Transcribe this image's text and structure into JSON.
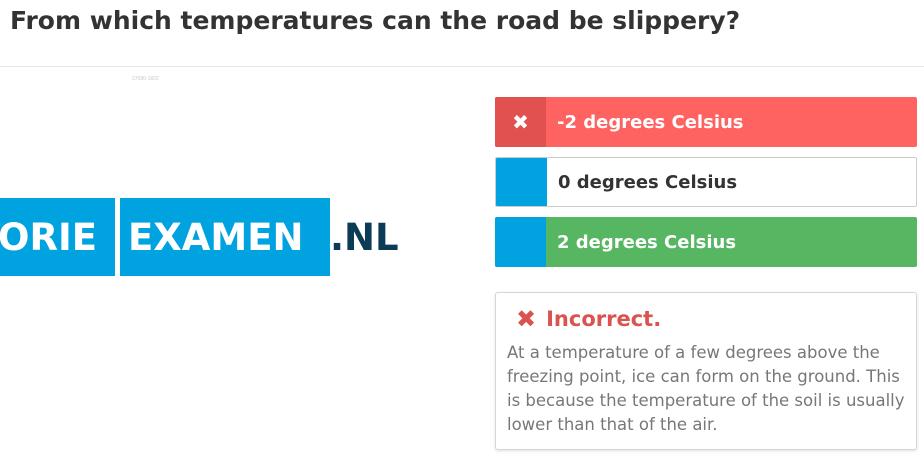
{
  "question": {
    "title": "From which temperatures can the road be slippery?"
  },
  "image": {
    "tiny_text": "27090-1822"
  },
  "logo": {
    "left": "ORIE",
    "right": "EXAMEN",
    "tld": ".NL"
  },
  "answers": [
    {
      "label": "-2 degrees Celsius",
      "state": "wrong",
      "marker_icon": "x-icon"
    },
    {
      "label": "0 degrees Celsius",
      "state": "neutral"
    },
    {
      "label": "2 degrees Celsius",
      "state": "correct"
    }
  ],
  "feedback": {
    "icon": "x-icon",
    "title": "Incorrect.",
    "body": "At a temperature of a few degrees above the freezing point, ice can form on the ground. This is because the temperature of the soil is usually lower than that of the air."
  },
  "colors": {
    "wrong": "#fe6362",
    "correct": "#56b661",
    "accent": "#00a3df",
    "feedback_title": "#d9534f"
  }
}
